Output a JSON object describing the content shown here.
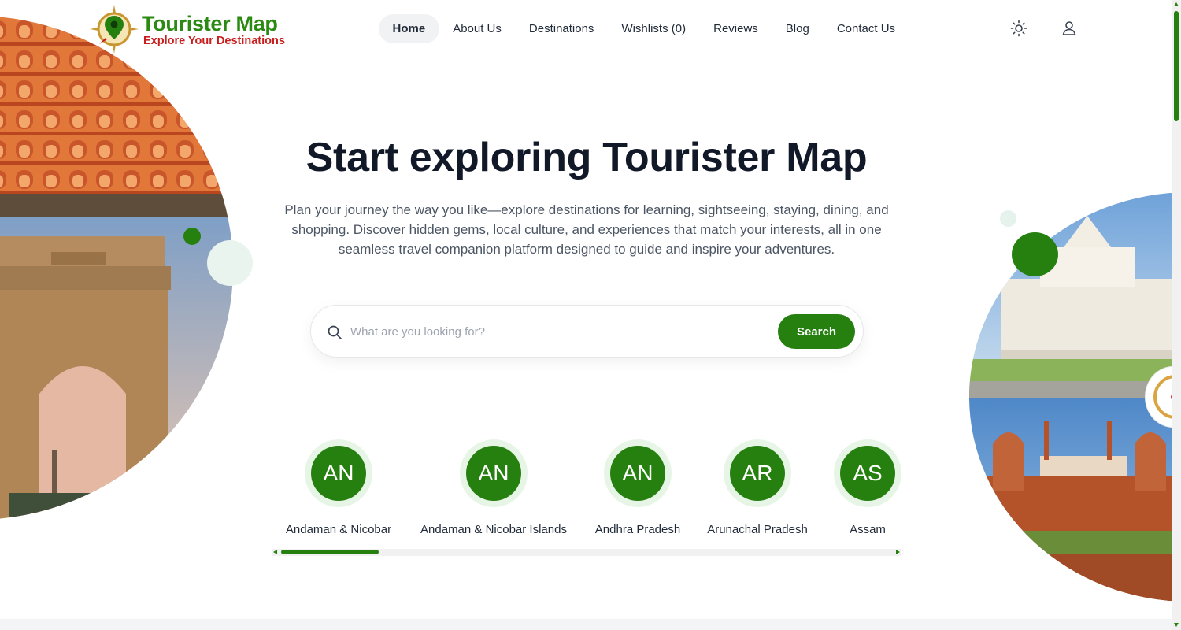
{
  "brand": {
    "name": "Tourister Map",
    "tagline": "Explore Your Destinations",
    "primary_color": "#268010",
    "accent_color": "#c81e1e"
  },
  "nav": {
    "items": [
      {
        "label": "Home",
        "active": true
      },
      {
        "label": "About Us"
      },
      {
        "label": "Destinations"
      },
      {
        "label": "Wishlists (0)"
      },
      {
        "label": "Reviews"
      },
      {
        "label": "Blog"
      },
      {
        "label": "Contact Us"
      }
    ],
    "icons": [
      "sun-icon",
      "user-icon"
    ]
  },
  "hero": {
    "title": "Start exploring Tourister Map",
    "subtitle": "Plan your journey the way you like—explore destinations for learning, sightseeing, staying, dining, and shopping. Discover hidden gems, local culture, and experiences that match your interests, all in one seamless travel companion platform designed to guide and inspire your adventures."
  },
  "search": {
    "placeholder": "What are you looking for?",
    "value": "",
    "button_label": "Search"
  },
  "states": [
    {
      "abbr": "AN",
      "name": "Andaman & Nicobar"
    },
    {
      "abbr": "AN",
      "name": "Andaman & Nicobar Islands"
    },
    {
      "abbr": "AN",
      "name": "Andhra Pradesh"
    },
    {
      "abbr": "AR",
      "name": "Arunachal Pradesh"
    },
    {
      "abbr": "AS",
      "name": "Assam"
    }
  ]
}
